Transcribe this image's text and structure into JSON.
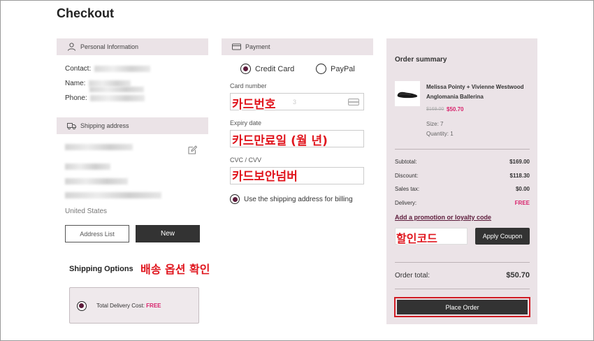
{
  "page": {
    "title": "Checkout"
  },
  "personal": {
    "header": "Personal Information",
    "contact_label": "Contact:",
    "name_label": "Name:",
    "phone_label": "Phone:"
  },
  "shipping_address": {
    "header": "Shipping address",
    "country": "United States",
    "address_list_label": "Address List",
    "new_label": "New"
  },
  "shipping_options": {
    "title": "Shipping Options",
    "delivery_cost_label": "Total Delivery Cost:",
    "delivery_cost_value": "FREE"
  },
  "payment": {
    "header": "Payment",
    "methods": [
      {
        "label": "Credit Card",
        "selected": true
      },
      {
        "label": "PayPal",
        "selected": false
      }
    ],
    "card_number_label": "Card number",
    "card_number_hint": "3",
    "expiry_label": "Expiry date",
    "cvc_label": "CVC / CVV",
    "billing_label": "Use the shipping address for billing"
  },
  "annotations": {
    "card_number": "카드번호",
    "expiry": "카드만료일 (월 년)",
    "cvc": "카드보안넘버",
    "coupon": "할인코드",
    "shipping": "배송 옵션 확인"
  },
  "summary": {
    "title": "Order summary",
    "product": {
      "name": "Melissa Pointy + Vivienne Westwood Anglomania Ballerina",
      "old_price": "$169.00",
      "new_price": "$50.70",
      "size": "Size: 7",
      "quantity": "Quantity: 1"
    },
    "rows": [
      {
        "label": "Subtotal:",
        "value": "$169.00"
      },
      {
        "label": "Discount:",
        "value": "$118.30"
      },
      {
        "label": "Sales tax:",
        "value": "$0.00"
      },
      {
        "label": "Delivery:",
        "value": "FREE"
      }
    ],
    "promo_link": "Add a promotion or loyalty code",
    "apply_coupon_label": "Apply Coupon",
    "total_label": "Order total:",
    "total_value": "$50.70",
    "place_order_label": "Place Order"
  },
  "colors": {
    "accent": "#5c1a3a",
    "pink": "#d8236c",
    "annotation": "#e0161e",
    "panel": "#ebe3e7"
  }
}
